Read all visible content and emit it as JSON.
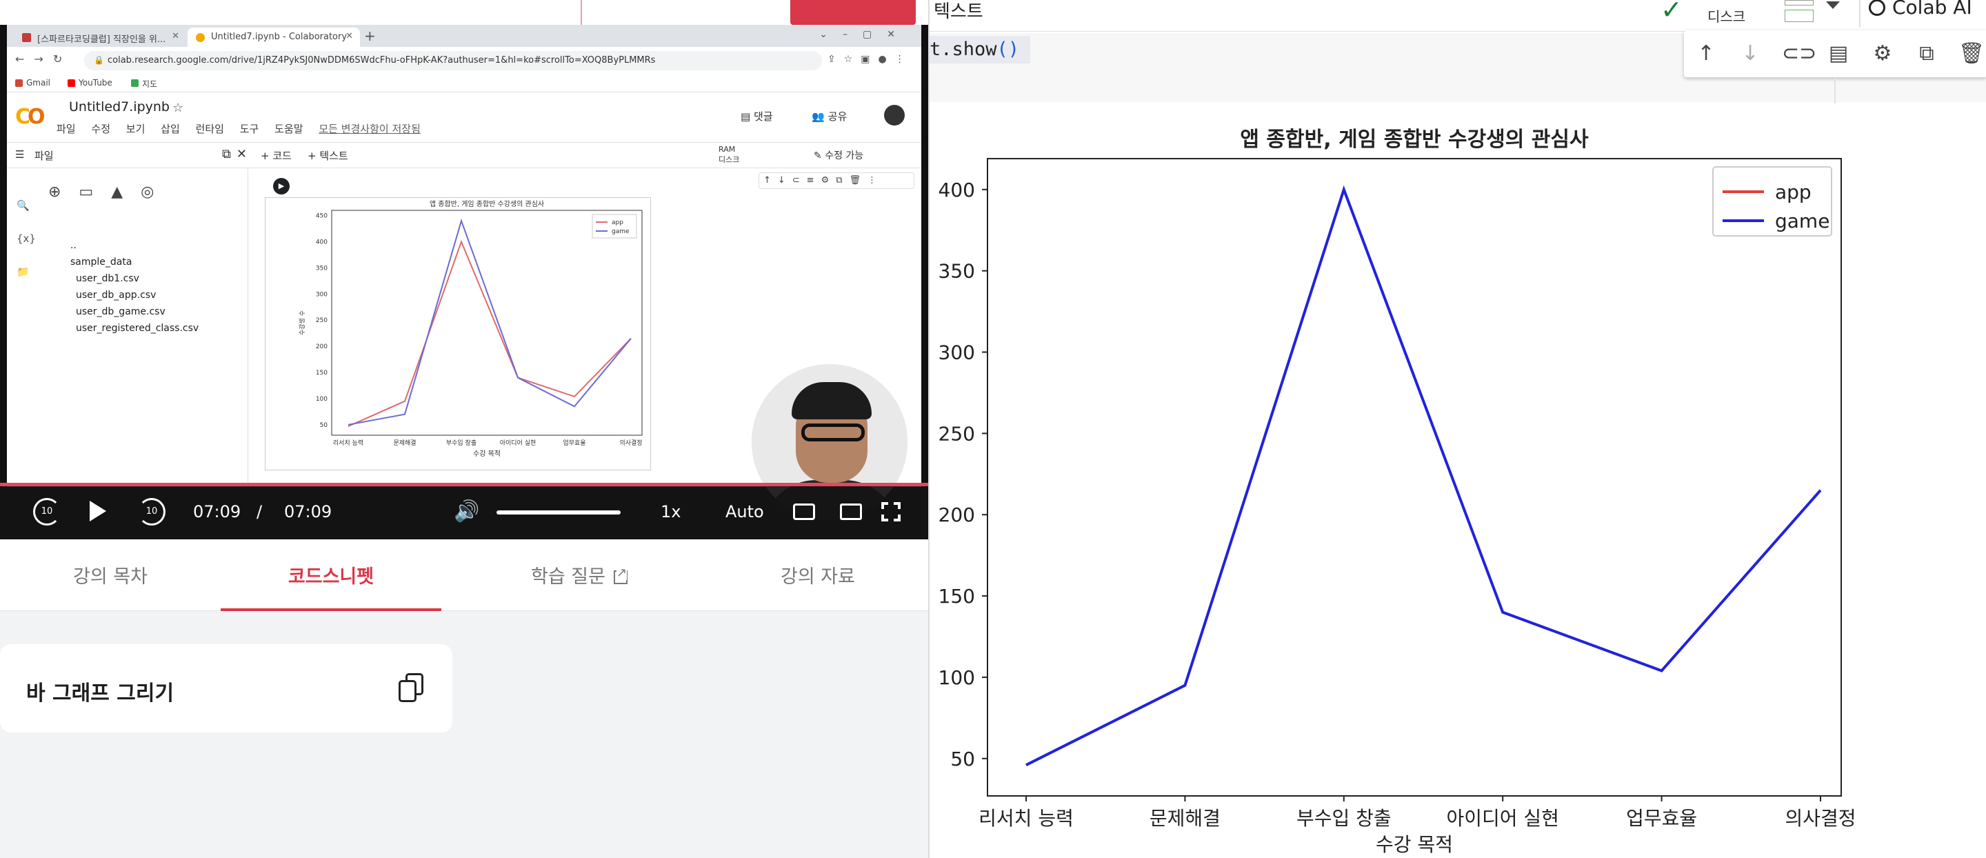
{
  "browser": {
    "tab1_title": "[스파르타코딩클럽] 직장인을 위...",
    "tab2_title": "Untitled7.ipynb - Colaboratory",
    "url": "colab.research.google.com/drive/1jRZ4PykSJ0NwDDM6SWdcFhu-oFHpK-AK?authuser=1&hl=ko#scrollTo=XOQ8ByPLMMRs",
    "bookmarks": [
      "Gmail",
      "YouTube",
      "지도"
    ]
  },
  "colab": {
    "notebook_title": "Untitled7.ipynb",
    "menus": [
      "파일",
      "수정",
      "보기",
      "삽입",
      "런타임",
      "도구",
      "도움말"
    ],
    "saved_status": "모든 변경사항이 저장됨",
    "comment_label": "댓글",
    "share_label": "공유",
    "files_label": "파일",
    "add_code": "+ 코드",
    "add_text": "+ 텍스트",
    "ram_label": "RAM",
    "disk_label": "디스크",
    "edit_label": "수정 가능",
    "files": [
      "..",
      "sample_data",
      "user_db1.csv",
      "user_db_app.csv",
      "user_db_game.csv",
      "user_registered_class.csv"
    ]
  },
  "player": {
    "current_time": "07:09",
    "separator": "/",
    "duration": "07:09",
    "speed": "1x",
    "quality": "Auto",
    "rewind_label": "10",
    "forward_label": "10",
    "progress": 1.0,
    "volume": 1.0
  },
  "lesson_tabs": {
    "toc": "강의 목차",
    "snippet": "코드스니펫",
    "qna": "학습 질문",
    "materials": "강의 자료"
  },
  "snippet": {
    "title": "바 그래프 그리기"
  },
  "right": {
    "text_label": "텍스트",
    "disk_label": "디스크",
    "ai_label": "Colab AI",
    "code_text": "t.show",
    "code_paren": "()"
  },
  "colors": {
    "app": "#e0403a",
    "game": "#2222dd",
    "accent": "#d8384a"
  },
  "chart_data": {
    "type": "line",
    "title": "앱 종합반, 게임 종합반 수강생의 관심사",
    "xlabel": "수강 목적",
    "ylabel": "",
    "categories": [
      "리서치 능력",
      "문제해결",
      "부수입 창출",
      "아이디어 실현",
      "업무효율",
      "의사결정"
    ],
    "series": [
      {
        "name": "app",
        "values": [
          46,
          95,
          400,
          140,
          104,
          215
        ]
      },
      {
        "name": "game",
        "values": [
          46,
          95,
          400,
          140,
          104,
          215
        ]
      }
    ],
    "ylim": [
      27,
      419
    ],
    "yticks": [
      50,
      100,
      150,
      200,
      250,
      300,
      350,
      400
    ],
    "legend": "top-right",
    "grid": false
  },
  "mini_chart": {
    "title": "앱 종합반, 게임 종합반 수강생의 관심사",
    "xlabel": "수강 목적",
    "ylabel": "수강생 수",
    "yticks": [
      50,
      100,
      150,
      200,
      250,
      300,
      350,
      400,
      450
    ],
    "ylim": [
      30,
      460
    ],
    "series": [
      {
        "name": "app",
        "values": [
          47,
          95,
          400,
          140,
          104,
          215
        ]
      },
      {
        "name": "game",
        "values": [
          50,
          70,
          440,
          140,
          85,
          215
        ]
      }
    ]
  }
}
